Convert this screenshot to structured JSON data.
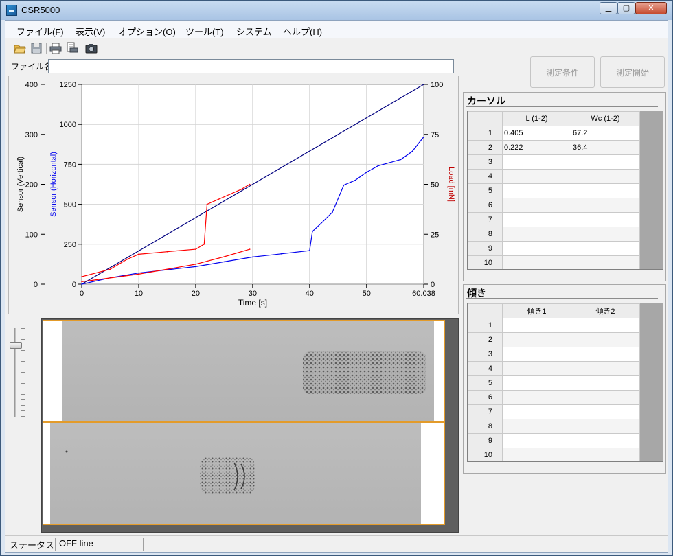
{
  "window": {
    "title": "CSR5000",
    "min_label": "▁",
    "max_label": "▢",
    "close_label": "✕"
  },
  "menu": [
    "ファイル(F)",
    "表示(V)",
    "オプション(O)",
    "ツール(T)",
    "システム",
    "ヘルプ(H)"
  ],
  "toolbar": {
    "icons": [
      "open-folder-icon",
      "save-icon",
      "print-icon",
      "print-preview-icon",
      "camera-icon"
    ]
  },
  "file": {
    "label": "ファイル名",
    "value": ""
  },
  "buttons": {
    "conditions": "測定条件",
    "start": "測定開始"
  },
  "chart_data": {
    "type": "line",
    "xlabel": "Time [s]",
    "ylabel_left": "Sensor (Vertical)",
    "ylabel_mid": "Sensor (Horizontal)",
    "ylabel_right": "Load [mN]",
    "xlim": [
      0,
      60.038
    ],
    "xticks": [
      "0",
      "10",
      "20",
      "30",
      "40",
      "50",
      "60.038"
    ],
    "y_vertical": {
      "lim": [
        0,
        400
      ],
      "ticks": [
        "0",
        "100",
        "200",
        "300",
        "400"
      ]
    },
    "y_horizontal": {
      "lim": [
        0,
        1250
      ],
      "ticks": [
        "0",
        "250",
        "500",
        "750",
        "1000",
        "1250"
      ]
    },
    "y_load": {
      "lim": [
        0,
        100
      ],
      "ticks": [
        "0",
        "25",
        "50",
        "75",
        "100"
      ]
    },
    "grid": true,
    "colors": {
      "vertical": "#ff0000",
      "horizontal": "#0000ee",
      "load": "#000080"
    },
    "series": [
      {
        "axis": "load",
        "color": "#000080",
        "x": [
          0,
          60.038
        ],
        "y": [
          0,
          100
        ]
      },
      {
        "axis": "horizontal",
        "color": "#0000ee",
        "x": [
          0,
          5,
          10,
          15,
          20,
          25,
          30,
          35,
          40,
          40.5,
          42,
          44,
          46,
          48,
          50,
          52,
          54,
          56,
          58,
          60
        ],
        "y": [
          0,
          40,
          70,
          90,
          110,
          140,
          170,
          190,
          210,
          330,
          380,
          450,
          620,
          650,
          700,
          740,
          760,
          780,
          830,
          920
        ]
      },
      {
        "axis": "vertical",
        "color": "#ff0000",
        "x": [
          0,
          5,
          8,
          10,
          15,
          20,
          21.5,
          22,
          24,
          26,
          28,
          29.5
        ],
        "y": [
          15,
          30,
          50,
          60,
          65,
          70,
          80,
          160,
          170,
          180,
          190,
          200
        ]
      },
      {
        "axis": "vertical",
        "color": "#ff0000",
        "x": [
          0,
          10,
          20,
          25,
          29.5
        ],
        "y": [
          5,
          20,
          40,
          55,
          70
        ]
      }
    ]
  },
  "cursor": {
    "title": "カーソル",
    "headers": [
      "L (1-2)",
      "Wc (1-2)"
    ],
    "rows": [
      {
        "n": "1",
        "a": "0.405",
        "b": "67.2"
      },
      {
        "n": "2",
        "a": "0.222",
        "b": "36.4"
      },
      {
        "n": "3",
        "a": "",
        "b": ""
      },
      {
        "n": "4",
        "a": "",
        "b": ""
      },
      {
        "n": "5",
        "a": "",
        "b": ""
      },
      {
        "n": "6",
        "a": "",
        "b": ""
      },
      {
        "n": "7",
        "a": "",
        "b": ""
      },
      {
        "n": "8",
        "a": "",
        "b": ""
      },
      {
        "n": "9",
        "a": "",
        "b": ""
      },
      {
        "n": "10",
        "a": "",
        "b": ""
      }
    ]
  },
  "slope": {
    "title": "傾き",
    "headers": [
      "傾き1",
      "傾き2"
    ],
    "rows": [
      {
        "n": "1",
        "a": "",
        "b": ""
      },
      {
        "n": "2",
        "a": "",
        "b": ""
      },
      {
        "n": "3",
        "a": "",
        "b": ""
      },
      {
        "n": "4",
        "a": "",
        "b": ""
      },
      {
        "n": "5",
        "a": "",
        "b": ""
      },
      {
        "n": "6",
        "a": "",
        "b": ""
      },
      {
        "n": "7",
        "a": "",
        "b": ""
      },
      {
        "n": "8",
        "a": "",
        "b": ""
      },
      {
        "n": "9",
        "a": "",
        "b": ""
      },
      {
        "n": "10",
        "a": "",
        "b": ""
      }
    ]
  },
  "status": {
    "label": "ステータス",
    "value": "OFF line"
  }
}
